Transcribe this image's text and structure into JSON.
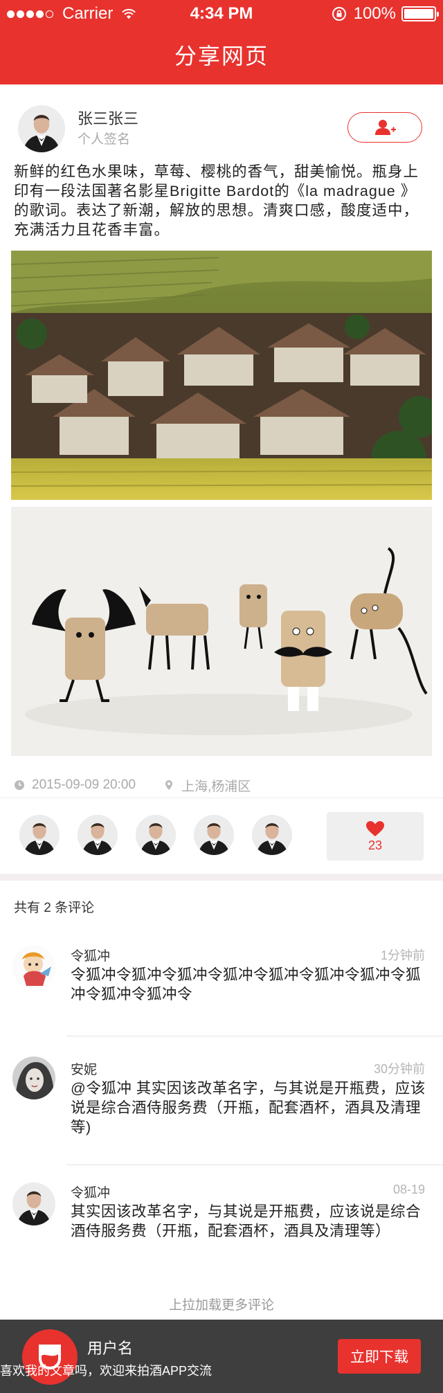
{
  "status_bar": {
    "carrier": "Carrier",
    "time": "4:34 PM",
    "battery": "100%",
    "battery_level": 1.0
  },
  "nav": {
    "title": "分享网页"
  },
  "author": {
    "name": "张三张三",
    "signature": "个人签名"
  },
  "article": {
    "text": "新鲜的红色水果味，草莓、樱桃的香气，甜美愉悦。瓶身上印有一段法国著名影星Brigitte Bardot的《la madrague 》的歌词。表达了新潮，解放的思想。清爽口感，酸度适中，充满活力且花香丰富。",
    "date": "2015-09-09 20:00",
    "location": "上海,杨浦区"
  },
  "likes": {
    "count": "23",
    "liker_count": 5
  },
  "comments": {
    "header": "共有 2 条评论",
    "items": [
      {
        "name": "令狐冲",
        "time": "1分钟前",
        "text": "令狐冲令狐冲令狐冲令狐冲令狐冲令狐冲令狐冲令狐冲令狐冲令狐冲令"
      },
      {
        "name": "安妮",
        "time": "30分钟前",
        "text": "@令狐冲 其实因该改革名字，与其说是开瓶费，应该说是综合酒侍服务费（开瓶，配套酒杯，酒具及清理等)"
      },
      {
        "name": "令狐冲",
        "time": "08-19",
        "text": "其实因该改革名字，与其说是开瓶费，应该说是综合酒侍服务费（开瓶，配套酒杯，酒具及清理等）"
      }
    ],
    "load_more": "上拉加载更多评论"
  },
  "bottom_bar": {
    "username": "用户名",
    "description": "喜欢我的文章吗，欢迎来拍酒APP交流",
    "download_label": "立即下载"
  },
  "colors": {
    "brand": "#e8322e",
    "bottom_bar": "#3e3e3e"
  }
}
